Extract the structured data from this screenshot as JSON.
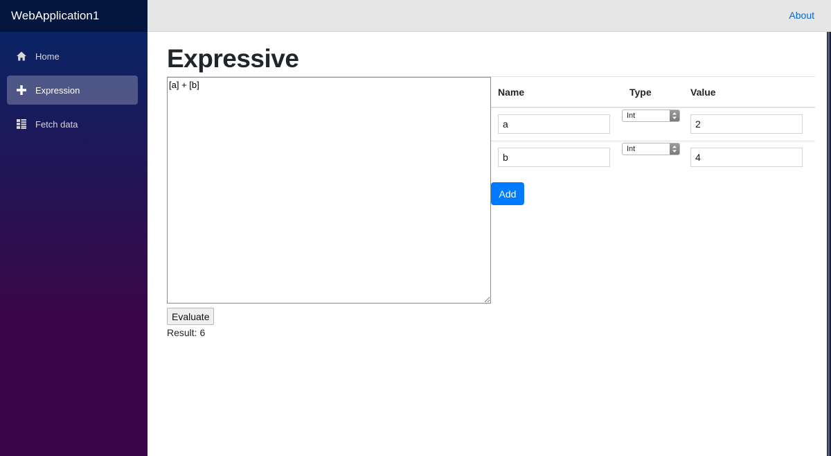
{
  "app": {
    "title": "WebApplication1"
  },
  "sidebar": {
    "items": [
      {
        "label": "Home",
        "icon": "home-icon",
        "active": false
      },
      {
        "label": "Expression",
        "icon": "plus-icon",
        "active": true
      },
      {
        "label": "Fetch data",
        "icon": "list-icon",
        "active": false
      }
    ]
  },
  "topbar": {
    "about_label": "About"
  },
  "page": {
    "title": "Expressive",
    "expression": "[a] + [b]",
    "evaluate_label": "Evaluate",
    "result_label": "Result:",
    "result_value": "6"
  },
  "variables": {
    "headers": {
      "name": "Name",
      "type": "Type",
      "value": "Value"
    },
    "rows": [
      {
        "name": "a",
        "type": "Int",
        "value": "2"
      },
      {
        "name": "b",
        "type": "Int",
        "value": "4"
      }
    ],
    "add_label": "Add"
  },
  "colors": {
    "accent": "#007bff",
    "link": "#0366d6",
    "sidebar_top": "#052767",
    "sidebar_bottom": "#3a0647"
  }
}
